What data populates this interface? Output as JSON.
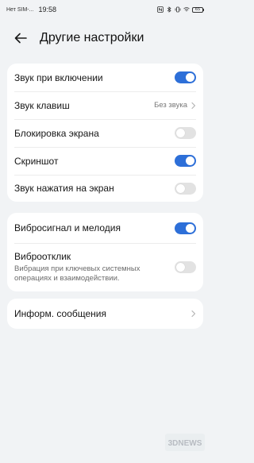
{
  "status_bar": {
    "carrier": "Нет SIM-...",
    "time": "19:58",
    "battery": "65"
  },
  "header": {
    "title": "Другие настройки"
  },
  "group1": {
    "rows": [
      {
        "label": "Звук при включении",
        "toggle": "on"
      },
      {
        "label": "Звук клавиш",
        "value": "Без звука"
      },
      {
        "label": "Блокировка экрана",
        "toggle": "off"
      },
      {
        "label": "Скриншот",
        "toggle": "on"
      },
      {
        "label": "Звук нажатия на экран",
        "toggle": "off"
      }
    ]
  },
  "group2": {
    "rows": [
      {
        "label": "Вибросигнал и мелодия",
        "toggle": "on"
      },
      {
        "label": "Виброотклик",
        "sublabel": "Вибрация при ключевых системных операциях и взаимодействии.",
        "toggle": "off"
      }
    ]
  },
  "group3": {
    "rows": [
      {
        "label": "Информ. сообщения"
      }
    ]
  },
  "watermark": {
    "text": "3DNEWS"
  },
  "colors": {
    "accent": "#2d6fd8",
    "background": "#f1f3f5",
    "card": "#ffffff",
    "toggle_off": "#e2e2e2"
  }
}
